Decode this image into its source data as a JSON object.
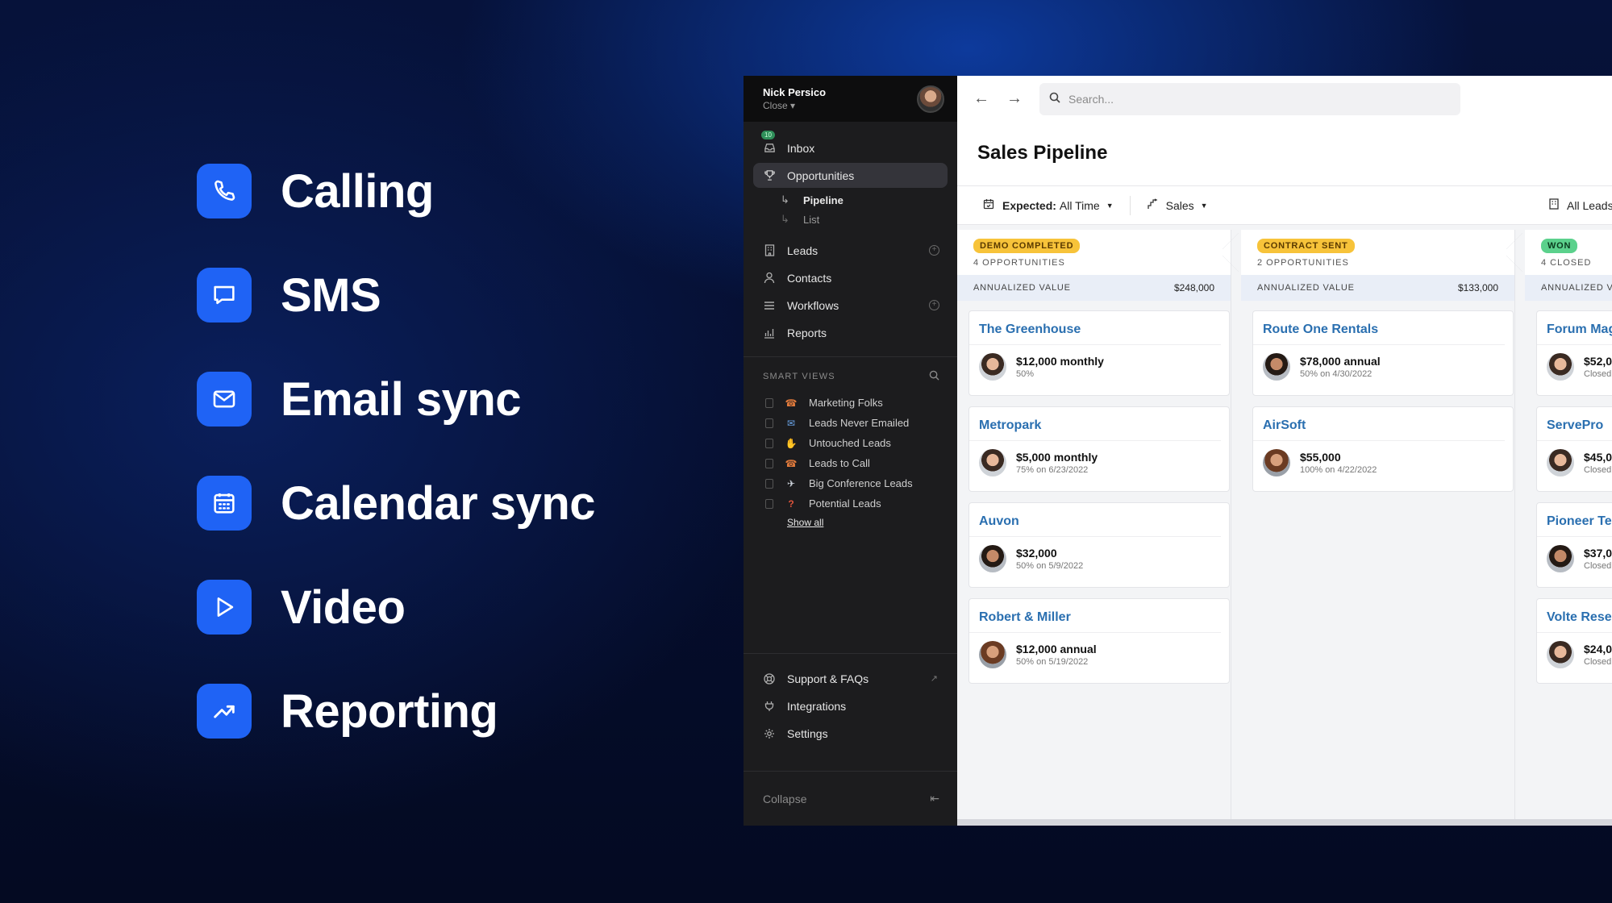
{
  "features": [
    {
      "icon": "phone-icon",
      "label": "Calling"
    },
    {
      "icon": "chat-bubble-icon",
      "label": "SMS"
    },
    {
      "icon": "envelope-icon",
      "label": "Email sync"
    },
    {
      "icon": "calendar-icon",
      "label": "Calendar sync"
    },
    {
      "icon": "play-icon",
      "label": "Video"
    },
    {
      "icon": "trend-up-icon",
      "label": "Reporting"
    }
  ],
  "accent_color": "#1f63f5",
  "sidebar": {
    "user_name": "Nick Persico",
    "org_name": "Close ▾",
    "inbox_badge": "10",
    "nav": [
      {
        "label": "Inbox",
        "icon": "inbox-icon"
      },
      {
        "label": "Opportunities",
        "icon": "trophy-icon",
        "active": true
      }
    ],
    "subnav": [
      {
        "label": "Pipeline",
        "icon": "pipeline-icon"
      },
      {
        "label": "List",
        "icon": "list-icon"
      }
    ],
    "nav2": [
      {
        "label": "Leads",
        "icon": "building-icon"
      },
      {
        "label": "Contacts",
        "icon": "person-icon"
      },
      {
        "label": "Workflows",
        "icon": "workflow-icon"
      },
      {
        "label": "Reports",
        "icon": "chart-icon"
      }
    ],
    "smart_views_heading": "SMART VIEWS",
    "smart_views": [
      {
        "emoji": "☎",
        "label": "Marketing Folks"
      },
      {
        "emoji": "✉",
        "label": "Leads Never Emailed"
      },
      {
        "emoji": "✋",
        "label": "Untouched Leads"
      },
      {
        "emoji": "☎",
        "label": "Leads to Call"
      },
      {
        "emoji": "✈",
        "label": "Big Conference Leads"
      },
      {
        "emoji": "?",
        "label": "Potential Leads"
      }
    ],
    "show_all": "Show all",
    "bottom": [
      {
        "label": "Support & FAQs",
        "icon": "lifebuoy-icon"
      },
      {
        "label": "Integrations",
        "icon": "plug-icon"
      },
      {
        "label": "Settings",
        "icon": "gear-icon"
      }
    ],
    "collapse": "Collapse"
  },
  "main": {
    "search_placeholder": "Search...",
    "title": "Sales Pipeline",
    "filter_expected_label": "Expected:",
    "filter_expected_value": "All Time",
    "filter_group": "Sales",
    "filter_right": "All Leads",
    "annualized_label": "ANNUALIZED VALUE",
    "columns": [
      {
        "stage": "DEMO COMPLETED",
        "color": "yellow",
        "count": "4 OPPORTUNITIES",
        "value": "$248,000",
        "cards": [
          {
            "title": "The Greenhouse",
            "amount": "$12,000 monthly",
            "sub": "50%",
            "face": "a"
          },
          {
            "title": "Metropark",
            "amount": "$5,000 monthly",
            "sub": "75% on 6/23/2022",
            "face": "a"
          },
          {
            "title": "Auvon",
            "amount": "$32,000",
            "sub": "50% on 5/9/2022",
            "face": "b"
          },
          {
            "title": "Robert & Miller",
            "amount": "$12,000 annual",
            "sub": "50% on 5/19/2022",
            "face": "c"
          }
        ]
      },
      {
        "stage": "CONTRACT SENT",
        "color": "yellow",
        "count": "2 OPPORTUNITIES",
        "value": "$133,000",
        "cards": [
          {
            "title": "Route One Rentals",
            "amount": "$78,000 annual",
            "sub": "50% on 4/30/2022",
            "face": "b"
          },
          {
            "title": "AirSoft",
            "amount": "$55,000",
            "sub": "100% on 4/22/2022",
            "face": "c"
          }
        ]
      },
      {
        "stage": "WON",
        "color": "green",
        "count": "4 CLOSED",
        "value": "",
        "cards": [
          {
            "title": "Forum Mag",
            "amount": "$52,0",
            "sub": "Closed",
            "face": "a"
          },
          {
            "title": "ServePro",
            "amount": "$45,0",
            "sub": "Closed",
            "face": "a"
          },
          {
            "title": "Pioneer Te",
            "amount": "$37,0",
            "sub": "Closed",
            "face": "b"
          },
          {
            "title": "Volte Rese",
            "amount": "$24,0",
            "sub": "Closed",
            "face": "a"
          }
        ]
      }
    ]
  }
}
